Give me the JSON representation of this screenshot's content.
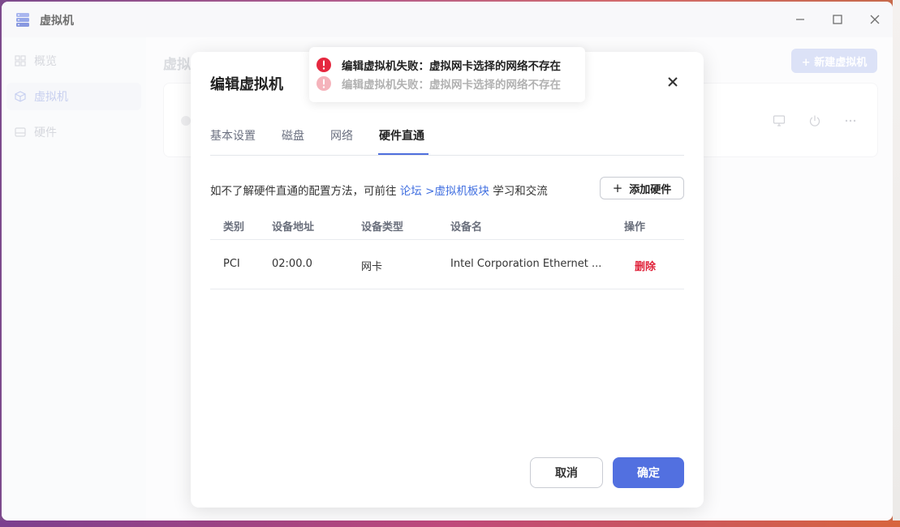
{
  "window": {
    "title": "虚拟机"
  },
  "sidebar": {
    "items": [
      {
        "label": "概览",
        "icon": "grid-icon",
        "active": false
      },
      {
        "label": "虚拟机",
        "icon": "cube-icon",
        "active": true
      },
      {
        "label": "硬件",
        "icon": "drive-icon",
        "active": false
      }
    ]
  },
  "content": {
    "title": "虚拟",
    "new_button": "+ 新建虚拟机"
  },
  "modal": {
    "title": "编辑虚拟机",
    "tabs": [
      {
        "label": "基本设置",
        "active": false
      },
      {
        "label": "磁盘",
        "active": false
      },
      {
        "label": "网络",
        "active": false
      },
      {
        "label": "硬件直通",
        "active": true
      }
    ],
    "hint_prefix": "如不了解硬件直通的配置方法，可前往 ",
    "hint_link": "论坛 >虚拟机板块",
    "hint_suffix": " 学习和交流",
    "add_button": "添加硬件",
    "table": {
      "headers": [
        "类别",
        "设备地址",
        "设备类型",
        "设备名",
        "操作"
      ],
      "rows": [
        {
          "category": "PCI",
          "address": "02:00.0",
          "type": "网卡",
          "name": "Intel Corporation Ethernet ...",
          "action": "删除"
        }
      ]
    },
    "cancel_button": "取消",
    "confirm_button": "确定"
  },
  "toasts": [
    {
      "text": "编辑虚拟机失败：虚拟网卡选择的网络不存在",
      "kind": "error"
    },
    {
      "text": "编辑虚拟机失败：虚拟网卡选择的网络不存在",
      "kind": "error"
    }
  ],
  "colors": {
    "accent": "#5270e0",
    "link": "#3f6ee0",
    "danger": "#e0223a",
    "error_icon": "#e5283f"
  }
}
